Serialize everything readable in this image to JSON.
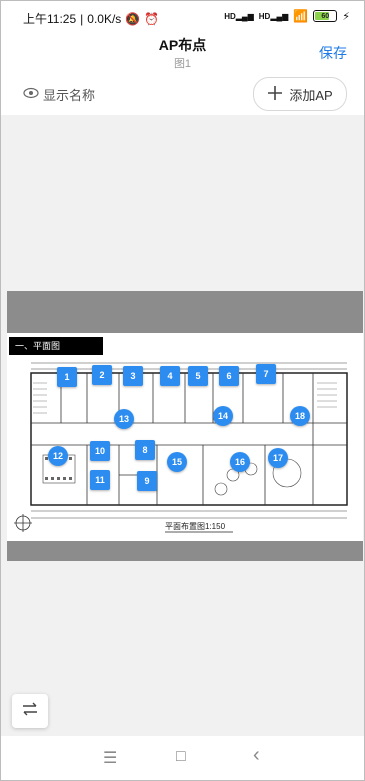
{
  "status_bar": {
    "time": "上午11:25",
    "speed": "0.0K/s",
    "signal1": "HD",
    "signal2": "HD",
    "battery": "60"
  },
  "header": {
    "title": "AP布点",
    "subtitle": "图1",
    "save_label": "保存"
  },
  "toolbar": {
    "show_name_label": "显示名称",
    "add_ap_label": "添加AP"
  },
  "plan": {
    "section_title": "一、平面图",
    "caption": "平面布置图1:150",
    "accent_color": "#2d8cf0",
    "markers": [
      "1",
      "2",
      "3",
      "4",
      "5",
      "6",
      "7",
      "13",
      "14",
      "18",
      "12",
      "10",
      "8",
      "15",
      "16",
      "17",
      "11",
      "9"
    ]
  },
  "nav": {
    "menu_icon": "☰",
    "home_icon": "□",
    "back_icon": "‹"
  }
}
